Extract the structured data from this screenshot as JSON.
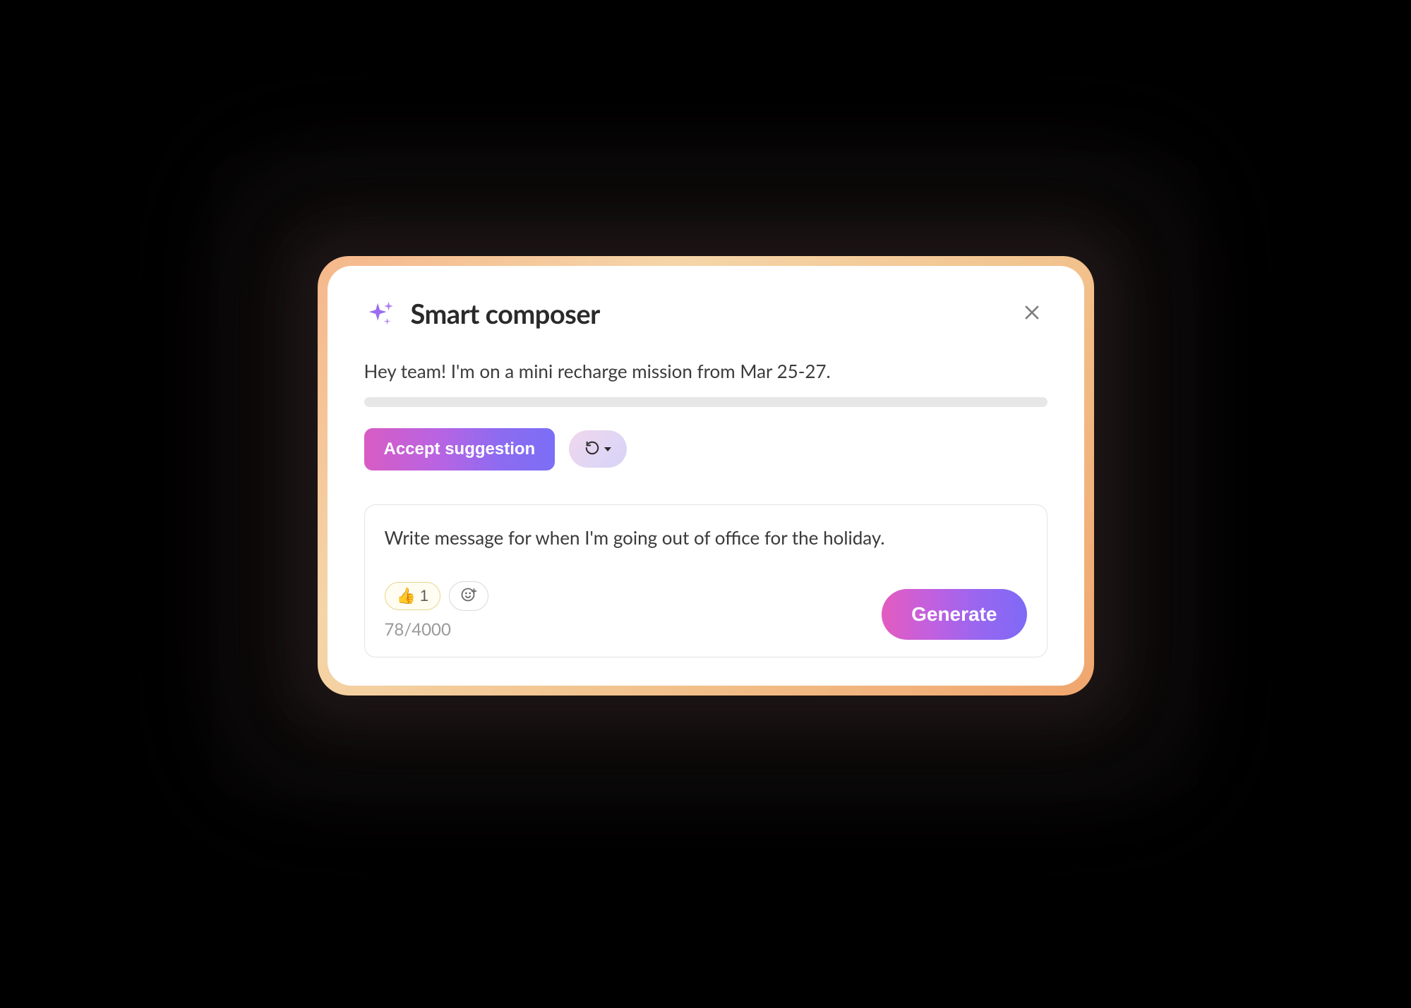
{
  "composer": {
    "title": "Smart composer",
    "suggestion_text": "Hey team! I'm on a mini recharge mission from Mar 25-27.",
    "accept_label": "Accept suggestion",
    "input_value": "Write message for when I'm going out of office for the holiday.",
    "reactions": {
      "thumbs_up_emoji": "👍",
      "thumbs_up_count": "1"
    },
    "char_counter": "78/4000",
    "generate_label": "Generate"
  },
  "icons": {
    "sparkle": "sparkle-icon",
    "close": "close-icon",
    "refresh": "refresh-icon",
    "caret_down": "chevron-down-icon",
    "add_reaction": "add-reaction-icon"
  },
  "colors": {
    "gradient_pink": "#e35cbf",
    "gradient_purple": "#7e6af6",
    "card_border_warm": "#f0a66e"
  }
}
